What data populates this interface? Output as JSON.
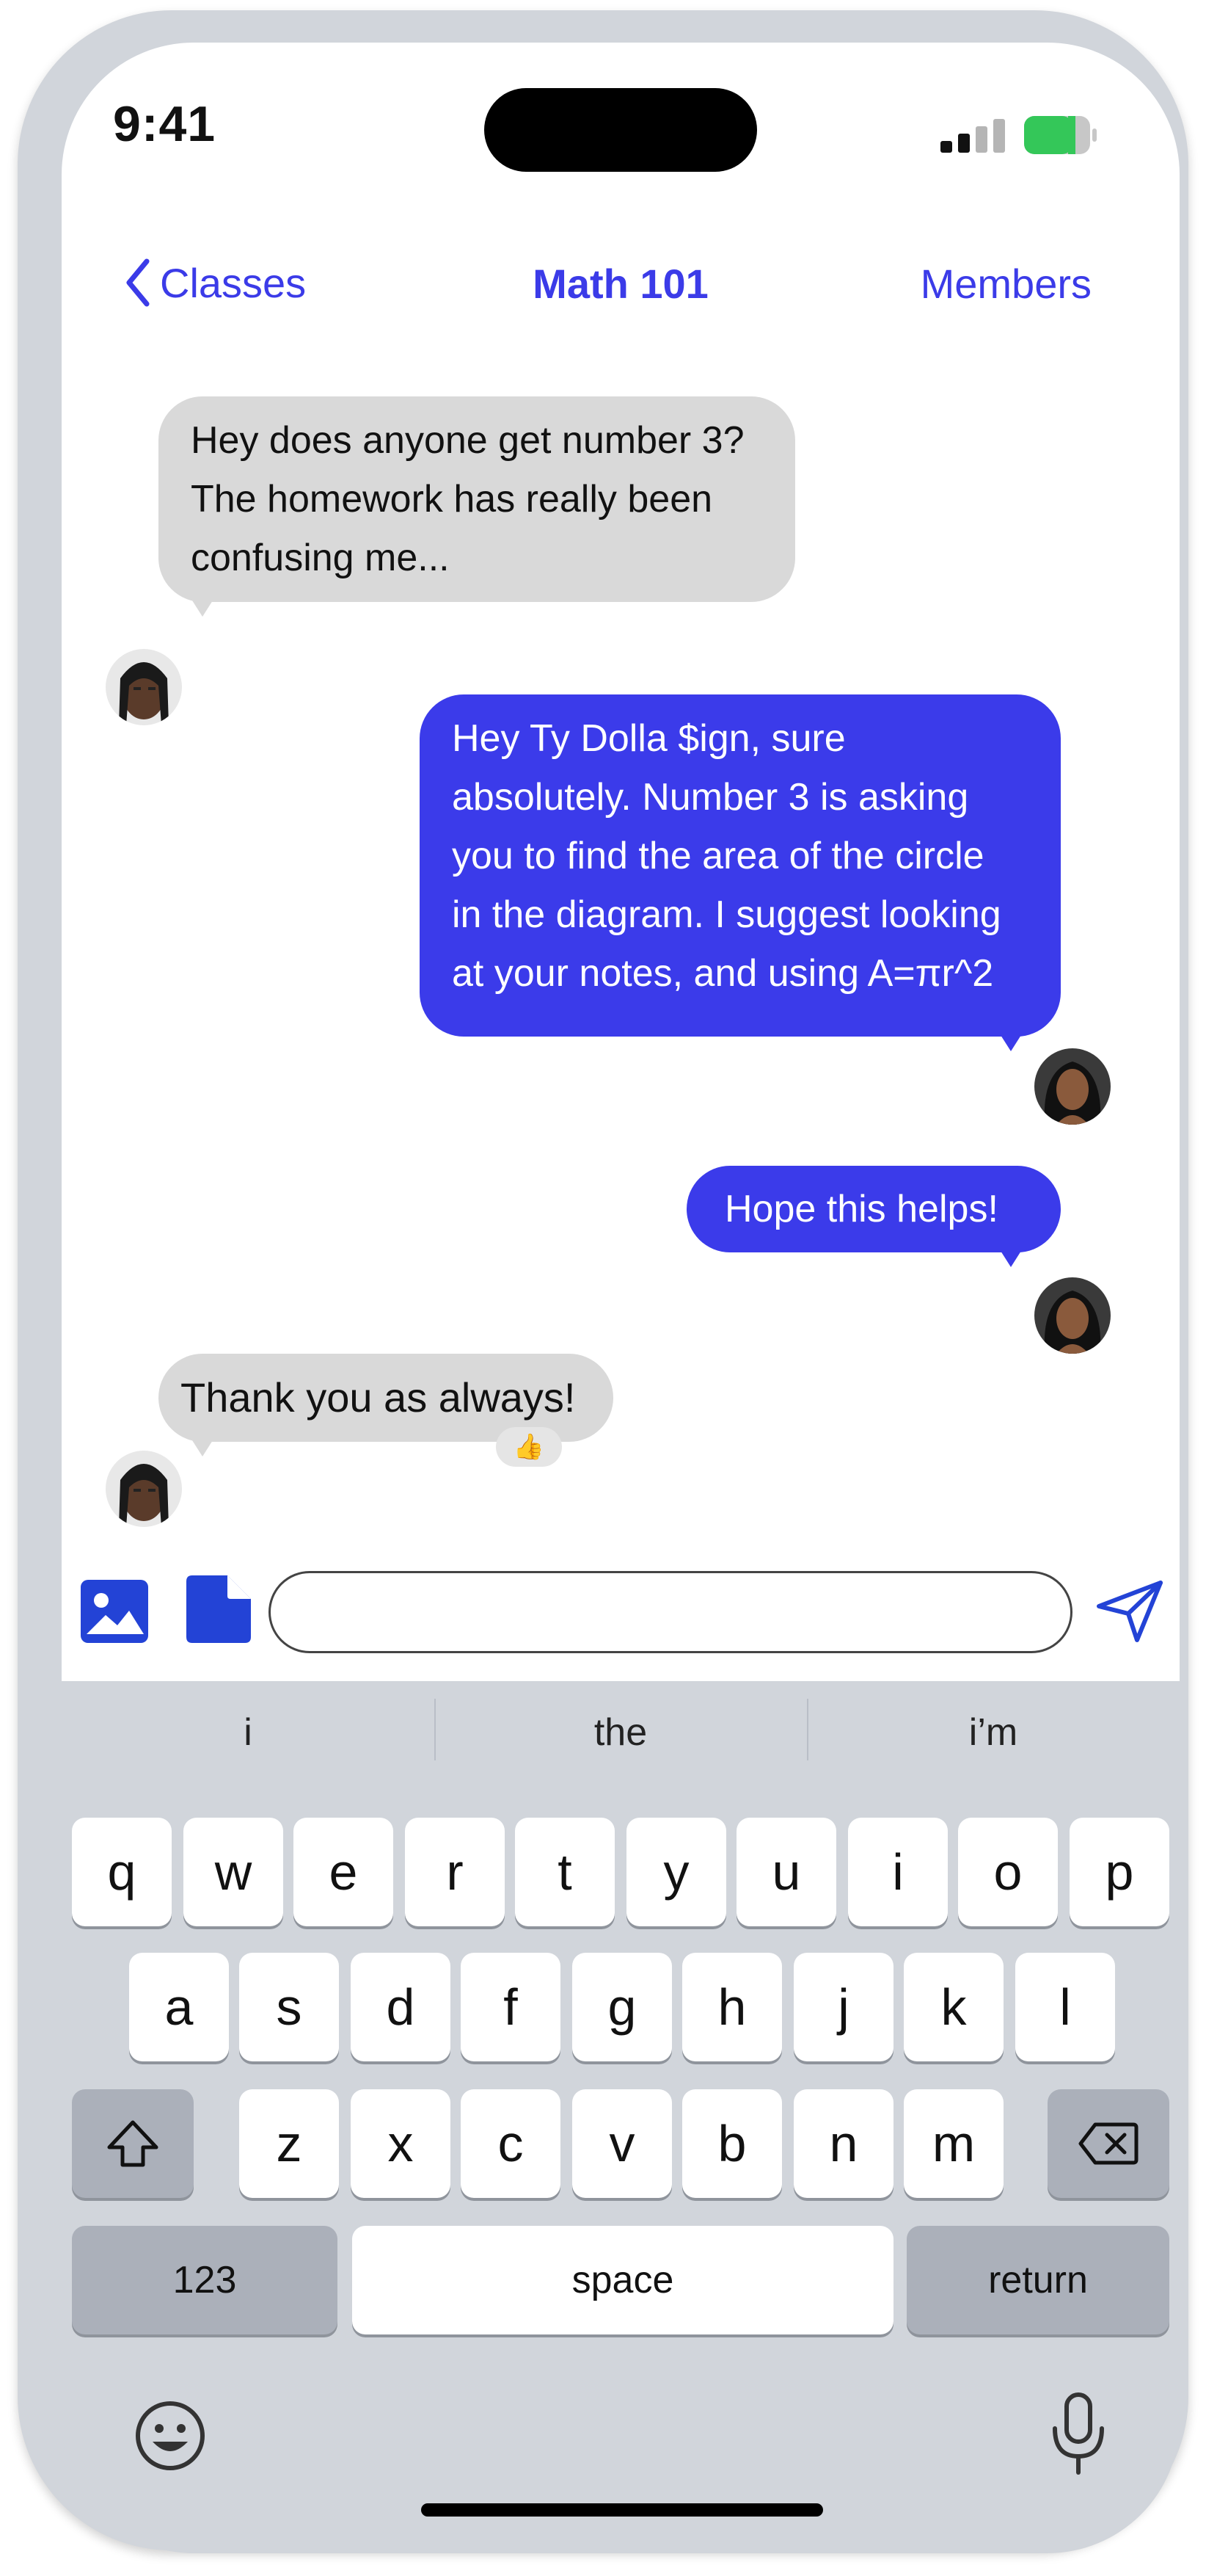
{
  "status_bar": {
    "time": "9:41",
    "signal_icon": "cellular-signal-icon",
    "battery_icon": "battery-icon"
  },
  "nav": {
    "back_label": "Classes",
    "title": "Math 101",
    "members_label": "Members"
  },
  "messages": [
    {
      "direction": "incoming",
      "lines": [
        "Hey does anyone get number 3?",
        "The homework has really been",
        "confusing me..."
      ]
    },
    {
      "direction": "outgoing",
      "lines": [
        "Hey Ty Dolla $ign, sure",
        "absolutely. Number 3 is asking",
        "you to find the area of the circle",
        "in the diagram. I suggest looking",
        "at your notes, and using A=πr^2"
      ]
    },
    {
      "direction": "outgoing",
      "lines": [
        "Hope this helps!"
      ]
    },
    {
      "direction": "incoming",
      "lines": [
        "Thank you as always!"
      ],
      "reaction": "👍"
    }
  ],
  "composer": {
    "image_icon": "image-icon",
    "file_icon": "file-icon",
    "send_icon": "send-icon",
    "value": ""
  },
  "keyboard": {
    "suggestions": [
      "i",
      "the",
      "i’m"
    ],
    "row1": [
      "q",
      "w",
      "e",
      "r",
      "t",
      "y",
      "u",
      "i",
      "o",
      "p"
    ],
    "row2": [
      "a",
      "s",
      "d",
      "f",
      "g",
      "h",
      "j",
      "k",
      "l"
    ],
    "row3": [
      "z",
      "x",
      "c",
      "v",
      "b",
      "n",
      "m"
    ],
    "numbers_label": "123",
    "space_label": "space",
    "return_label": "return"
  },
  "colors": {
    "accent": "#3b3bea",
    "incoming_bubble": "#d9d9d9",
    "keyboard_bg": "#d1d5db"
  }
}
